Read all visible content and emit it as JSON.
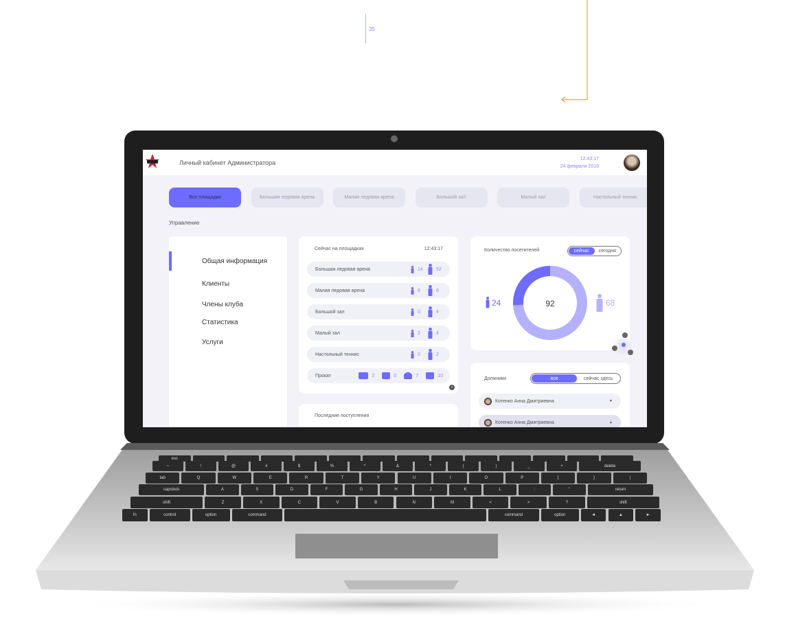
{
  "page_number": "35",
  "colors": {
    "accent": "#6e6cff",
    "accent_light": "#b4b2ff",
    "annotation": "#f0a030"
  },
  "header": {
    "title": "Личный кабинет Администратора",
    "time": "12:43:17",
    "date": "24 февраля 2019",
    "logo_icon": "club-star-logo",
    "avatar_icon": "user-avatar"
  },
  "tabs": [
    {
      "label": "Все площадки",
      "active": true
    },
    {
      "label": "Большая ледовая арена"
    },
    {
      "label": "Малая ледовая арена"
    },
    {
      "label": "Большой зал"
    },
    {
      "label": "Малый зал"
    },
    {
      "label": "Настольный теннис"
    }
  ],
  "section_title": "Управление",
  "sidebar": {
    "items": [
      {
        "label": "Общая информация",
        "active": true
      },
      {
        "label": "Клиенты"
      },
      {
        "label": "Члены клуба"
      },
      {
        "label": "Статистика"
      },
      {
        "label": "Услуги"
      }
    ]
  },
  "now_on_sites": {
    "title": "Сейчас на площадках",
    "time": "12:43:17",
    "rows": [
      {
        "name": "Большая ледовая арена",
        "children": "14",
        "adults": "52"
      },
      {
        "name": "Малая ледовая арена",
        "children": "8",
        "adults": "6"
      },
      {
        "name": "Большой зал",
        "children": "0",
        "adults": "4"
      },
      {
        "name": "Малый зал",
        "children": "2",
        "adults": "4"
      },
      {
        "name": "Настольный теннис",
        "children": "0",
        "adults": "2"
      }
    ],
    "rental": {
      "name": "Прокат",
      "items": [
        {
          "icon": "skate-stick-icon",
          "count": "2"
        },
        {
          "icon": "jersey-icon",
          "count": "0"
        },
        {
          "icon": "helmet-icon",
          "count": "7"
        },
        {
          "icon": "skate-icon",
          "count": "10"
        }
      ]
    },
    "info_badge": "i"
  },
  "latest": {
    "title": "Последние поступления"
  },
  "visitors": {
    "title": "Количество посетителей",
    "toggle": [
      "сейчас",
      "сегодня"
    ],
    "active_toggle": "сейчас",
    "total": "92",
    "children": "24",
    "adults": "68"
  },
  "debtors": {
    "title": "Должники",
    "toggle": [
      "все",
      "сейчас здесь"
    ],
    "active_toggle": "все",
    "items": [
      {
        "name": "Котенко Анна Дмитриевна",
        "expanded": false
      },
      {
        "name": "Котенко Анна Дмитриевна",
        "expanded": true
      }
    ]
  },
  "keyboard": {
    "row0": [
      "esc",
      "",
      "",
      "",
      "",
      "",
      "",
      "",
      "",
      "",
      "",
      "",
      "",
      ""
    ],
    "row1": [
      "~",
      "!",
      "@",
      "#",
      "$",
      "%",
      "^",
      "&",
      "*",
      "(",
      ")",
      "_",
      "+",
      "delete"
    ],
    "row2": [
      "tab",
      "Q",
      "W",
      "E",
      "R",
      "T",
      "Y",
      "U",
      "I",
      "O",
      "P",
      "{",
      "}",
      "|"
    ],
    "row3": [
      "capslock",
      "A",
      "S",
      "D",
      "F",
      "G",
      "H",
      "J",
      "K",
      "L",
      ":",
      "\"",
      "return"
    ],
    "row4": [
      "shift",
      "Z",
      "X",
      "C",
      "V",
      "B",
      "N",
      "M",
      "<",
      ">",
      "?",
      "shift"
    ],
    "row5": [
      "fn",
      "control",
      "option",
      "command",
      "",
      "command",
      "option",
      "◄",
      "▲",
      "►"
    ]
  }
}
